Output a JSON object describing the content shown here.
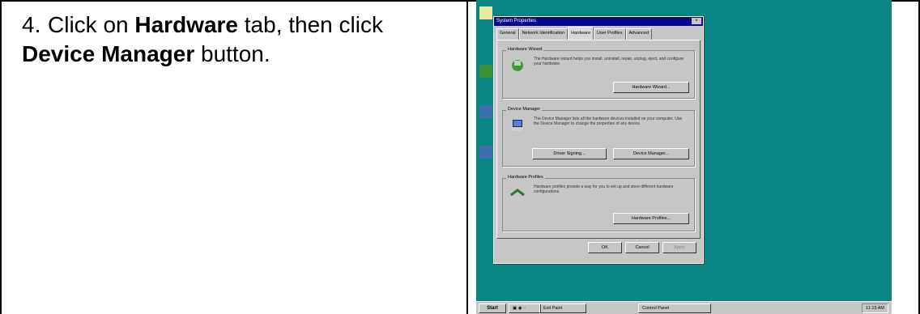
{
  "instruction": {
    "number": "4.",
    "pre1": "Click on ",
    "bold1": "Hardware",
    "mid": " tab, then click ",
    "bold2": "Device Manager",
    "post": " button."
  },
  "screenshot": {
    "dialog_title": "System Properties",
    "close_glyph": "×",
    "tabs": [
      "General",
      "Network Identification",
      "Hardware",
      "User Profiles",
      "Advanced"
    ],
    "active_tab": "Hardware",
    "groups": {
      "wizard": {
        "label": "Hardware Wizard",
        "text": "The Hardware wizard helps you install, uninstall, repair, unplug, eject, and configure your hardware.",
        "button": "Hardware Wizard..."
      },
      "devmgr": {
        "label": "Device Manager",
        "text": "The Device Manager lists all the hardware devices installed on your computer. Use the Device Manager to change the properties of any device.",
        "button_left": "Driver Signing...",
        "button_right": "Device Manager..."
      },
      "profiles": {
        "label": "Hardware Profiles",
        "text": "Hardware profiles provide a way for you to set up and store different hardware configurations.",
        "button": "Hardware Profiles..."
      }
    },
    "buttons": {
      "ok": "OK",
      "cancel": "Cancel",
      "apply": "Apply"
    },
    "taskbar": {
      "start": "Start",
      "item1": "Exit Paint",
      "item2": "Control Panel",
      "clock": "11:15 AM"
    },
    "colors": {
      "desktop": "#0a8585",
      "titlebar": "#08088a",
      "window": "#c6c6c6"
    }
  }
}
